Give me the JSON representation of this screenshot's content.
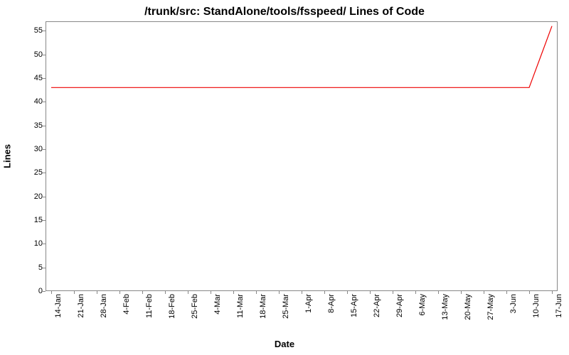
{
  "chart_data": {
    "type": "line",
    "title": "/trunk/src: StandAlone/tools/fsspeed/ Lines of Code",
    "xlabel": "Date",
    "ylabel": "Lines",
    "ylim": [
      0,
      57
    ],
    "y_ticks": [
      0,
      5,
      10,
      15,
      20,
      25,
      30,
      35,
      40,
      45,
      50,
      55
    ],
    "categories": [
      "14-Jan",
      "21-Jan",
      "28-Jan",
      "4-Feb",
      "11-Feb",
      "18-Feb",
      "25-Feb",
      "4-Mar",
      "11-Mar",
      "18-Mar",
      "25-Mar",
      "1-Apr",
      "8-Apr",
      "15-Apr",
      "22-Apr",
      "29-Apr",
      "6-May",
      "13-May",
      "20-May",
      "27-May",
      "3-Jun",
      "10-Jun",
      "17-Jun"
    ],
    "values": [
      43,
      43,
      43,
      43,
      43,
      43,
      43,
      43,
      43,
      43,
      43,
      43,
      43,
      43,
      43,
      43,
      43,
      43,
      43,
      43,
      43,
      43,
      56
    ],
    "series_color": "#ee0000"
  }
}
